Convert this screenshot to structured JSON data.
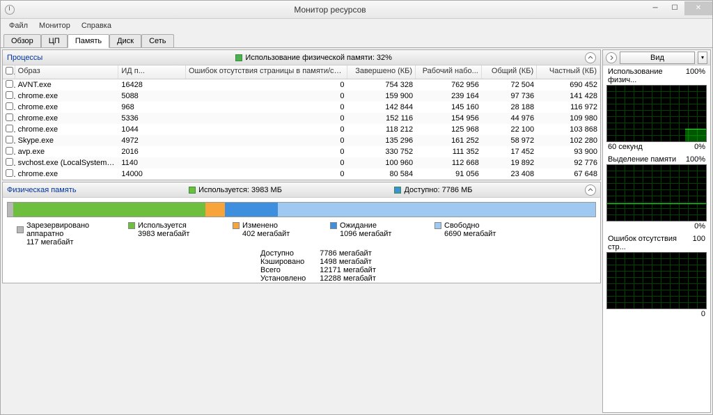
{
  "window": {
    "title": "Монитор ресурсов"
  },
  "menu": [
    "Файл",
    "Монитор",
    "Справка"
  ],
  "tabs": {
    "items": [
      "Обзор",
      "ЦП",
      "Память",
      "Диск",
      "Сеть"
    ],
    "active": 2
  },
  "processes": {
    "title": "Процессы",
    "usage_label": "Использование физической памяти: 32%",
    "headers": {
      "image": "Образ",
      "pid": "ИД п...",
      "err": "Ошибок отсутствия страницы в памяти/сек.",
      "commit": "Завершено (КБ)",
      "ws": "Рабочий набо...",
      "shared": "Общий (КБ)",
      "private": "Частный (КБ)"
    },
    "rows": [
      {
        "image": "AVNT.exe",
        "pid": "16428",
        "err": "0",
        "commit": "754 328",
        "ws": "762 956",
        "shared": "72 504",
        "private": "690 452"
      },
      {
        "image": "chrome.exe",
        "pid": "5088",
        "err": "0",
        "commit": "159 900",
        "ws": "239 164",
        "shared": "97 736",
        "private": "141 428"
      },
      {
        "image": "chrome.exe",
        "pid": "968",
        "err": "0",
        "commit": "142 844",
        "ws": "145 160",
        "shared": "28 188",
        "private": "116 972"
      },
      {
        "image": "chrome.exe",
        "pid": "5336",
        "err": "0",
        "commit": "152 116",
        "ws": "154 956",
        "shared": "44 976",
        "private": "109 980"
      },
      {
        "image": "chrome.exe",
        "pid": "1044",
        "err": "0",
        "commit": "118 212",
        "ws": "125 968",
        "shared": "22 100",
        "private": "103 868"
      },
      {
        "image": "Skype.exe",
        "pid": "4972",
        "err": "0",
        "commit": "135 296",
        "ws": "161 252",
        "shared": "58 972",
        "private": "102 280"
      },
      {
        "image": "avp.exe",
        "pid": "2016",
        "err": "0",
        "commit": "330 752",
        "ws": "111 352",
        "shared": "17 452",
        "private": "93 900"
      },
      {
        "image": "svchost.exe (LocalSystemNet...",
        "pid": "1140",
        "err": "0",
        "commit": "100 960",
        "ws": "112 668",
        "shared": "19 892",
        "private": "92 776"
      },
      {
        "image": "chrome.exe",
        "pid": "14000",
        "err": "0",
        "commit": "80 584",
        "ws": "91 056",
        "shared": "23 408",
        "private": "67 648"
      }
    ]
  },
  "phys_mem": {
    "title": "Физическая память",
    "used_label": "Используется: 3983 МБ",
    "avail_label": "Доступно: 7786 МБ",
    "segments": [
      {
        "color": "#b8b8b8",
        "width": 1.0
      },
      {
        "color": "#6fbf3f",
        "width": 32.7
      },
      {
        "color": "#f7a53b",
        "width": 3.3
      },
      {
        "color": "#3e8fde",
        "width": 9.0
      },
      {
        "color": "#9fc9f0",
        "width": 54.0
      }
    ],
    "legend": [
      {
        "color": "#b8b8b8",
        "label": "Зарезервировано аппаратно",
        "value": "117 мегабайт"
      },
      {
        "color": "#6fbf3f",
        "label": "Используется",
        "value": "3983 мегабайт"
      },
      {
        "color": "#f7a53b",
        "label": "Изменено",
        "value": "402 мегабайт"
      },
      {
        "color": "#3e8fde",
        "label": "Ожидание",
        "value": "1096 мегабайт"
      },
      {
        "color": "#9fc9f0",
        "label": "Свободно",
        "value": "6690 мегабайт"
      }
    ],
    "details": {
      "labels": [
        "Доступно",
        "Кэшировано",
        "Всего",
        "Установлено"
      ],
      "values": [
        "7786 мегабайт",
        "1498 мегабайт",
        "12171 мегабайт",
        "12288 мегабайт"
      ]
    }
  },
  "right": {
    "vid": "Вид",
    "g1": {
      "title": "Использование физич...",
      "max": "100%",
      "sub_l": "60 секунд",
      "sub_r": "0%"
    },
    "g2": {
      "title": "Выделение памяти",
      "max": "100%",
      "sub_r": "0%"
    },
    "g3": {
      "title": "Ошибок отсутствия стр...",
      "max": "100",
      "sub_r": "0"
    }
  }
}
